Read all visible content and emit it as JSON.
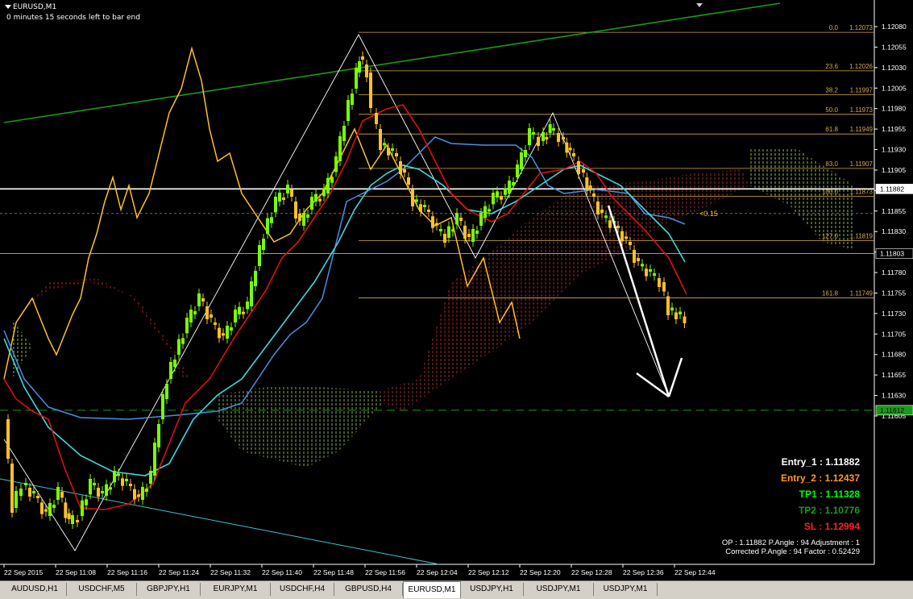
{
  "header": {
    "symbol": "EURUSD,M1",
    "bar_timer": "0 minutes 15 seconds left to bar end"
  },
  "colors": {
    "background": "#000000",
    "bull_candle": "#7cfc00",
    "bear_candle": "#ffc125",
    "fib_line": "#d4aa50",
    "tenkan": "#e01010",
    "kijun": "#4a90e2",
    "cyan_ma": "#40d8e0",
    "chikou": "#ffc125",
    "trendline": "#1a9a1a",
    "tp1": "#00ff00",
    "tp2": "#1a9a1a",
    "sl": "#ff2020",
    "entry2": "#ff9a1a"
  },
  "price_axis": {
    "ticks": [
      "1.12080",
      "1.12055",
      "1.12030",
      "1.12005",
      "1.11980",
      "1.11955",
      "1.11930",
      "1.11905",
      "1.11880",
      "1.11855",
      "1.11830",
      "1.11805",
      "1.11780",
      "1.11755",
      "1.11730",
      "1.11705",
      "1.11680",
      "1.11655",
      "1.11630",
      "1.11605"
    ],
    "current_price": "1.11803",
    "entry_price_box": "1.11882",
    "bottom_box": "1.11612"
  },
  "time_axis": {
    "labels": [
      "22 Sep 2015",
      "22 Sep 11:08",
      "22 Sep 11:16",
      "22 Sep 11:24",
      "22 Sep 11:32",
      "22 Sep 11:40",
      "22 Sep 11:48",
      "22 Sep 11:56",
      "22 Sep 12:04",
      "22 Sep 12:12",
      "22 Sep 12:20",
      "22 Sep 12:28",
      "22 Sep 12:36",
      "22 Sep 12:44"
    ]
  },
  "fib_levels": [
    {
      "level": "0.0",
      "price": "1.12073"
    },
    {
      "level": "23.6",
      "price": "1.12026"
    },
    {
      "level": "38.2",
      "price": "1.11997"
    },
    {
      "level": "50.0",
      "price": "1.11973"
    },
    {
      "level": "61.8",
      "price": "1.11949"
    },
    {
      "level": "83.0",
      "price": "1.11907"
    },
    {
      "level": "100.0",
      "price": "1.11873"
    },
    {
      "level": "127.0",
      "price": "1.11819"
    },
    {
      "level": "161.8",
      "price": "1.11749"
    }
  ],
  "spread_label": "<0.15",
  "trade_info": {
    "entry1": "Entry_1 : 1.11882",
    "entry2": "Entry_2 : 1.12437",
    "tp1": "TP1 : 1.11328",
    "tp2": "TP2 : 1.10776",
    "sl": "SL : 1.12994",
    "op_line": "OP : 1.11882   P.Angle : 94   Adjustment : 1",
    "corrected_line": "Corrected P.Angle : 94   Factor : 0.52429"
  },
  "tabs": [
    {
      "label": "AUDUSD,H1",
      "active": false
    },
    {
      "label": "USDCHF,M5",
      "active": false
    },
    {
      "label": "GBPJPY,H1",
      "active": false
    },
    {
      "label": "EURJPY,M1",
      "active": false
    },
    {
      "label": "USDCHF,H4",
      "active": false
    },
    {
      "label": "GBPUSD,H4",
      "active": false
    },
    {
      "label": "EURUSD,M1",
      "active": true
    },
    {
      "label": "USDJPY,H1",
      "active": false
    },
    {
      "label": "USDJPY,M1",
      "active": false
    },
    {
      "label": "USDJPY,M1",
      "active": false
    }
  ]
}
